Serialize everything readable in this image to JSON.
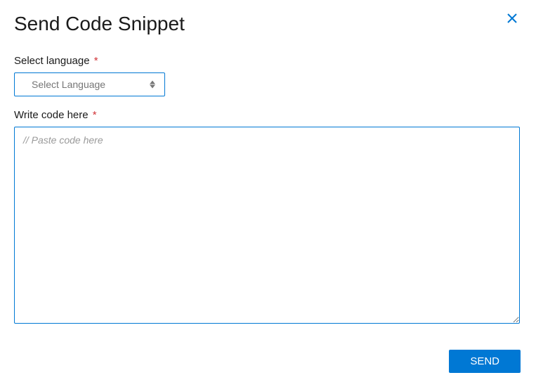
{
  "header": {
    "title": "Send Code Snippet"
  },
  "form": {
    "language": {
      "label": "Select language",
      "required": "*",
      "placeholder": "Select Language",
      "value": ""
    },
    "code": {
      "label": "Write code here",
      "required": "*",
      "placeholder": "// Paste code here",
      "value": ""
    }
  },
  "footer": {
    "send_label": "SEND"
  }
}
